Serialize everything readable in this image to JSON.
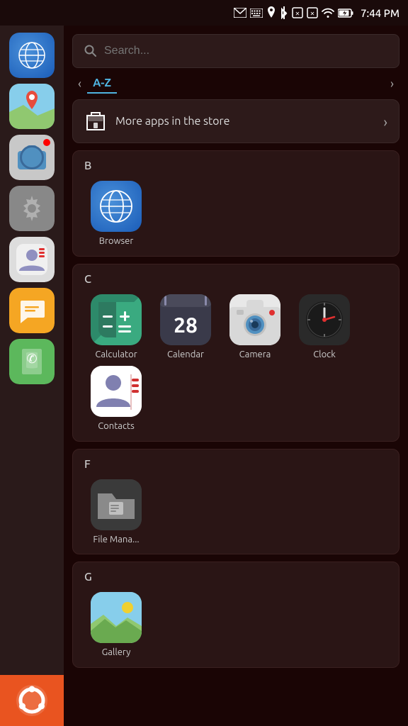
{
  "statusBar": {
    "time": "7:44 PM",
    "icons": [
      "mail",
      "keyboard",
      "location",
      "bluetooth",
      "sim1",
      "sim2",
      "wifi",
      "battery"
    ]
  },
  "search": {
    "placeholder": "Search..."
  },
  "tabs": {
    "left_arrow": "‹",
    "active": "A-Z",
    "right_arrow": "›"
  },
  "store": {
    "label": "More apps in the store",
    "chevron": "›"
  },
  "sections": [
    {
      "letter": "B",
      "apps": [
        {
          "name": "Browser",
          "icon": "browser"
        }
      ]
    },
    {
      "letter": "C",
      "apps": [
        {
          "name": "Calculator",
          "icon": "calculator"
        },
        {
          "name": "Calendar",
          "icon": "calendar",
          "day": "28"
        },
        {
          "name": "Camera",
          "icon": "camera"
        },
        {
          "name": "Clock",
          "icon": "clock"
        },
        {
          "name": "Contacts",
          "icon": "contacts"
        }
      ]
    },
    {
      "letter": "F",
      "apps": [
        {
          "name": "File Mana...",
          "icon": "filemanager"
        }
      ]
    },
    {
      "letter": "G",
      "apps": [
        {
          "name": "Gallery",
          "icon": "gallery"
        }
      ]
    }
  ],
  "sidebar": {
    "apps": [
      {
        "name": "Browser",
        "icon": "sb-browser"
      },
      {
        "name": "Maps",
        "icon": "sb-maps"
      },
      {
        "name": "Camera",
        "icon": "sb-camera"
      },
      {
        "name": "Settings",
        "icon": "sb-settings"
      },
      {
        "name": "Contacts",
        "icon": "sb-contacts"
      },
      {
        "name": "Messaging",
        "icon": "sb-messaging"
      },
      {
        "name": "Phone",
        "icon": "sb-phone"
      }
    ],
    "ubuntu_button": "Ubuntu"
  }
}
